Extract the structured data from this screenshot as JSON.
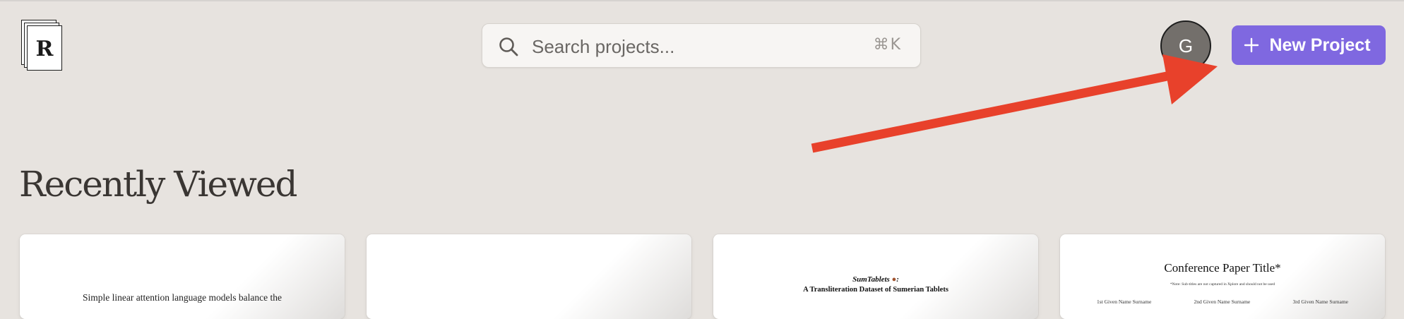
{
  "logo": {
    "letter": "R"
  },
  "search": {
    "placeholder": "Search projects...",
    "value": "",
    "shortcut": "⌘K",
    "icon": "search-icon"
  },
  "user": {
    "initial": "G"
  },
  "actions": {
    "new_project_label": "New Project",
    "icon": "plus-icon"
  },
  "annotation": {
    "color": "#e8412b",
    "shape": "arrow"
  },
  "section": {
    "title": "Recently Viewed"
  },
  "projects": [
    {
      "preview_text": "Simple linear attention language models balance the"
    },
    {
      "preview_text": ""
    },
    {
      "preview_title": "SumTablets",
      "preview_subtitle": "A Transliteration Dataset of Sumerian Tablets"
    },
    {
      "preview_title": "Conference Paper Title*",
      "preview_note": "*Note: Sub-titles are not captured in Xplore and should not be used",
      "authors": [
        "1st Given Name Surname",
        "2nd Given Name Surname",
        "3rd Given Name Surname"
      ]
    }
  ],
  "colors": {
    "background": "#e7e3df",
    "accent": "#7f68e0",
    "avatar": "#736f6b",
    "heading": "#3a3633"
  }
}
